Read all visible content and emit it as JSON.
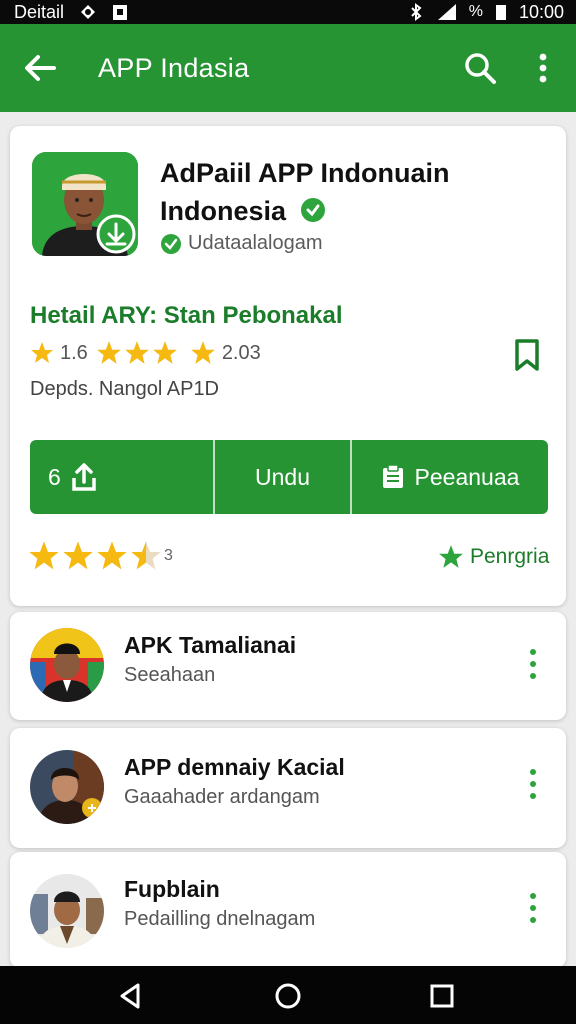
{
  "status_bar": {
    "left_text": "Deitail",
    "time": "10:00",
    "battery_text": "%"
  },
  "app_bar": {
    "title": "APP Indasia"
  },
  "app": {
    "name_line1": "AdPaiil APP Indonuain",
    "name_line2": "Indonesia",
    "developer": "Udataalalogam",
    "section_title": "Hetail ARY: Stan Pebonakal",
    "rating_left": "1.6",
    "rating_right": "2.03",
    "meta": "Depds. Nangol AP1D"
  },
  "actions": {
    "count_label": "6",
    "download_label": "Undu",
    "secondary_label": "Peeanuaa"
  },
  "bottom": {
    "rating_suffix": "3",
    "premium_label": "Penrgria"
  },
  "list": [
    {
      "title": "APK Tamalianai",
      "subtitle": "Seeahaan"
    },
    {
      "title": "APP demnaiy Kacial",
      "subtitle": "Gaaahader ardangam"
    },
    {
      "title": "Fupblain",
      "subtitle": "Pedailling dnelnagam"
    }
  ],
  "colors": {
    "primary": "#279433",
    "dark_green": "#1b7d2a",
    "star": "#f5b912"
  },
  "icons": [
    "back-arrow-icon",
    "search-icon",
    "more-vert-icon",
    "verified-icon",
    "bookmark-icon",
    "share-icon",
    "calendar-icon",
    "star-icon",
    "nav-back-icon",
    "nav-home-icon",
    "nav-recent-icon"
  ]
}
